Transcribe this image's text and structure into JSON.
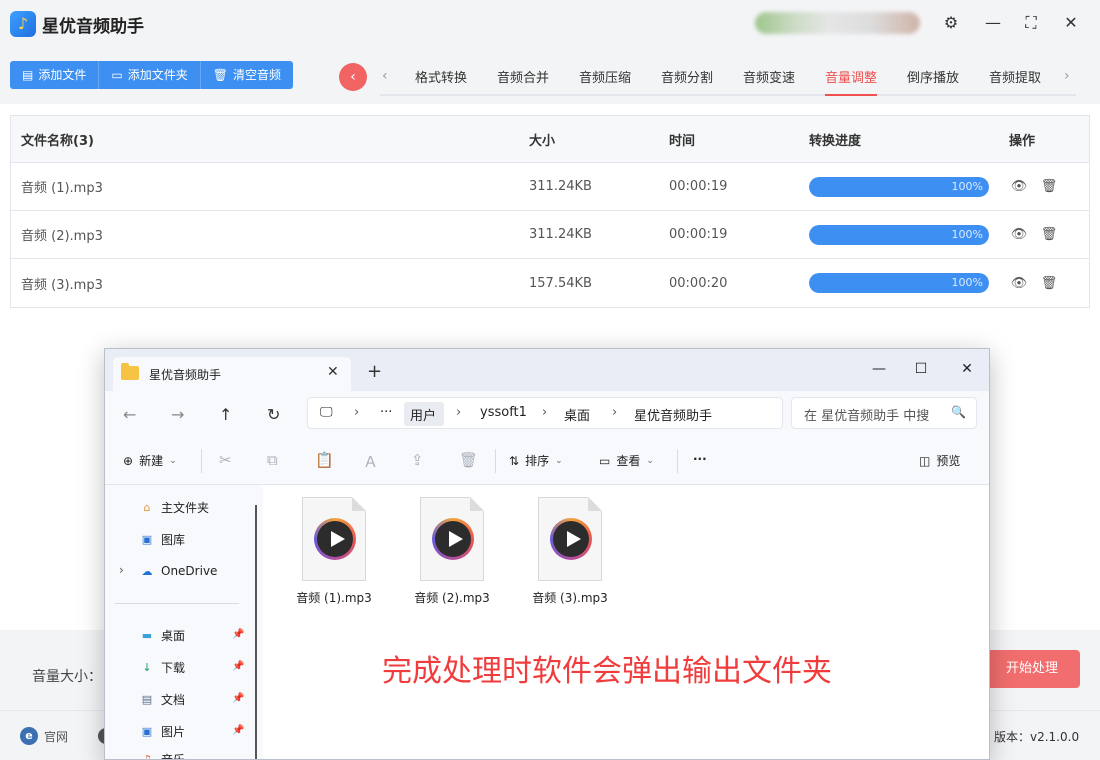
{
  "app": {
    "title": "星优音频助手",
    "toolbar": {
      "add_file": "添加文件",
      "add_folder": "添加文件夹",
      "clear_audio": "清空音频"
    },
    "tabs": [
      {
        "label": "格式转换"
      },
      {
        "label": "音频合并"
      },
      {
        "label": "音频压缩"
      },
      {
        "label": "音频分割"
      },
      {
        "label": "音频变速"
      },
      {
        "label": "音量调整",
        "active": true
      },
      {
        "label": "倒序播放"
      },
      {
        "label": "音频提取"
      }
    ],
    "table": {
      "headers": {
        "name": "文件名称(3)",
        "size": "大小",
        "time": "时间",
        "progress": "转换进度",
        "ops": "操作"
      },
      "rows": [
        {
          "name": "音频 (1).mp3",
          "size": "311.24KB",
          "time": "00:00:19",
          "progress": 100,
          "progress_label": "100%"
        },
        {
          "name": "音频 (2).mp3",
          "size": "311.24KB",
          "time": "00:00:19",
          "progress": 100,
          "progress_label": "100%"
        },
        {
          "name": "音频 (3).mp3",
          "size": "157.54KB",
          "time": "00:00:20",
          "progress": 100,
          "progress_label": "100%"
        }
      ]
    },
    "volume_label": "音量大小：",
    "start_button": "开始处理",
    "footer": {
      "site": "官网",
      "version": "版本：v2.1.0.0"
    },
    "colors": {
      "accent": "#3d8ff2",
      "active_tab": "#f05050",
      "start": "#f26e6e"
    }
  },
  "explorer": {
    "tab_title": "星优音频助手",
    "new_button": "新建",
    "sort_button": "排序",
    "view_button": "查看",
    "more": "···",
    "preview": "预览",
    "address": {
      "ellipsis": "···",
      "parts": [
        "用户",
        "yssoft1",
        "桌面",
        "星优音频助手"
      ]
    },
    "search_placeholder": "在 星优音频助手 中搜",
    "sidebar": {
      "home": "主文件夹",
      "gallery": "图库",
      "onedrive": "OneDrive",
      "desktop": "桌面",
      "downloads": "下载",
      "documents": "文档",
      "pictures": "图片",
      "music": "音乐"
    },
    "files": [
      {
        "name": "音频 (1).mp3"
      },
      {
        "name": "音频 (2).mp3"
      },
      {
        "name": "音频 (3).mp3"
      }
    ]
  },
  "annotation": "完成处理时软件会弹出输出文件夹"
}
